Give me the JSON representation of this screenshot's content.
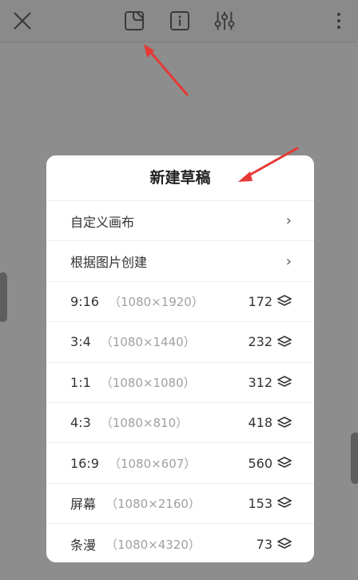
{
  "toolbar": {
    "icons": [
      "close-icon",
      "canvas-crop-icon",
      "info-icon",
      "sliders-icon",
      "more-vertical-icon"
    ]
  },
  "dialog": {
    "title": "新建草稿",
    "actions": [
      {
        "label": "自定义画布"
      },
      {
        "label": "根据图片创建"
      }
    ],
    "presets": [
      {
        "ratio": "9:16",
        "size": "（1080×1920）",
        "layers": "172"
      },
      {
        "ratio": "3:4",
        "size": "（1080×1440）",
        "layers": "232"
      },
      {
        "ratio": "1:1",
        "size": "（1080×1080）",
        "layers": "312"
      },
      {
        "ratio": "4:3",
        "size": "（1080×810）",
        "layers": "418"
      },
      {
        "ratio": "16:9",
        "size": "（1080×607）",
        "layers": "560"
      },
      {
        "ratio": "屏幕",
        "size": "（1080×2160）",
        "layers": "153"
      },
      {
        "ratio": "条漫",
        "size": "（1080×4320）",
        "layers": "73"
      }
    ],
    "chevron": "›"
  },
  "colors": {
    "overlay": "#8d8d8d",
    "dialog_bg": "#ffffff",
    "annotation_arrow": "#e53935"
  }
}
